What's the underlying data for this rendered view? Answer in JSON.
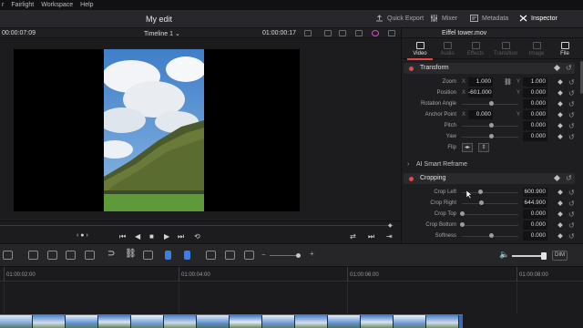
{
  "menu": [
    "r",
    "Fairlight",
    "Workspace",
    "Help"
  ],
  "project_title": "My edit",
  "panels": [
    {
      "label": "Quick Export",
      "icon": "export-icon"
    },
    {
      "label": "Mixer",
      "icon": "mixer-icon"
    },
    {
      "label": "Metadata",
      "icon": "metadata-icon"
    },
    {
      "label": "Inspector",
      "icon": "inspector-icon",
      "active": true
    }
  ],
  "viewer": {
    "timecode_left": "00:00:07:09",
    "timeline_name": "Timeline 1",
    "timecode_right": "01:00:00:17"
  },
  "inspector": {
    "clip_name": "Eiffel tower.mov",
    "tabs": [
      "Video",
      "Audio",
      "Effects",
      "Transition",
      "Image",
      "File"
    ],
    "active_tab": "Video",
    "transform": {
      "title": "Transform",
      "zoom_label": "Zoom",
      "zoom_x": "1.000",
      "zoom_y": "1.000",
      "position_label": "Position",
      "position_x": "-601.000",
      "position_y": "0.000",
      "rotation_label": "Rotation Angle",
      "rotation": "0.000",
      "anchor_label": "Anchor Point",
      "anchor_x": "0.000",
      "anchor_y": "0.000",
      "pitch_label": "Pitch",
      "pitch": "0.000",
      "yaw_label": "Yaw",
      "yaw": "0.000",
      "flip_label": "Flip",
      "x_axis": "X",
      "y_axis": "Y"
    },
    "smart_reframe": {
      "title": "AI Smart Reframe"
    },
    "cropping": {
      "title": "Cropping",
      "crop_left_label": "Crop Left",
      "crop_left": "600.900",
      "crop_right_label": "Crop Right",
      "crop_right": "644.900",
      "crop_top_label": "Crop Top",
      "crop_top": "0.000",
      "crop_bottom_label": "Crop Bottom",
      "crop_bottom": "0.000",
      "softness_label": "Softness",
      "softness": "0.000"
    }
  },
  "toolbar": {
    "dim_label": "DIM"
  },
  "timeline": {
    "ticks": [
      "01:00:02:00",
      "01:00:04:00",
      "01:00:06:00",
      "01:00:08:00"
    ]
  },
  "colors": {
    "accent": "#e84545",
    "blue": "#3b7fe0"
  }
}
